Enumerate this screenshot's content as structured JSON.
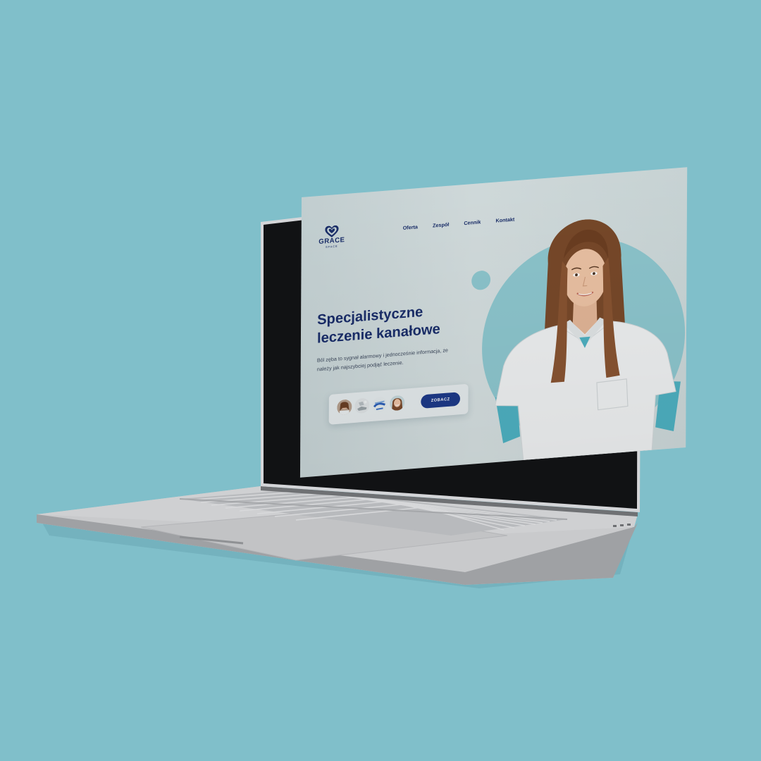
{
  "background_color": "#80bfca",
  "brand": {
    "name": "GRACE",
    "tagline": "SPACE",
    "accent": "#1a2e6b",
    "button_color": "#1d3a8a"
  },
  "nav": [
    {
      "label": "Oferta"
    },
    {
      "label": "Zespół"
    },
    {
      "label": "Cennik"
    },
    {
      "label": "Kontakt"
    }
  ],
  "hero": {
    "title_line1": "Specjalistyczne",
    "title_line2": "leczenie kanałowe",
    "description": "Ból zęba to sygnał alarmowy i jednocześnie informacja, że należy jak najszybciej podjąć leczenie."
  },
  "card": {
    "button_label": "ZOBACZ",
    "thumbnails": [
      "woman-portrait-icon",
      "dental-chair-icon",
      "dental-tools-icon",
      "smiling-woman-icon"
    ]
  }
}
